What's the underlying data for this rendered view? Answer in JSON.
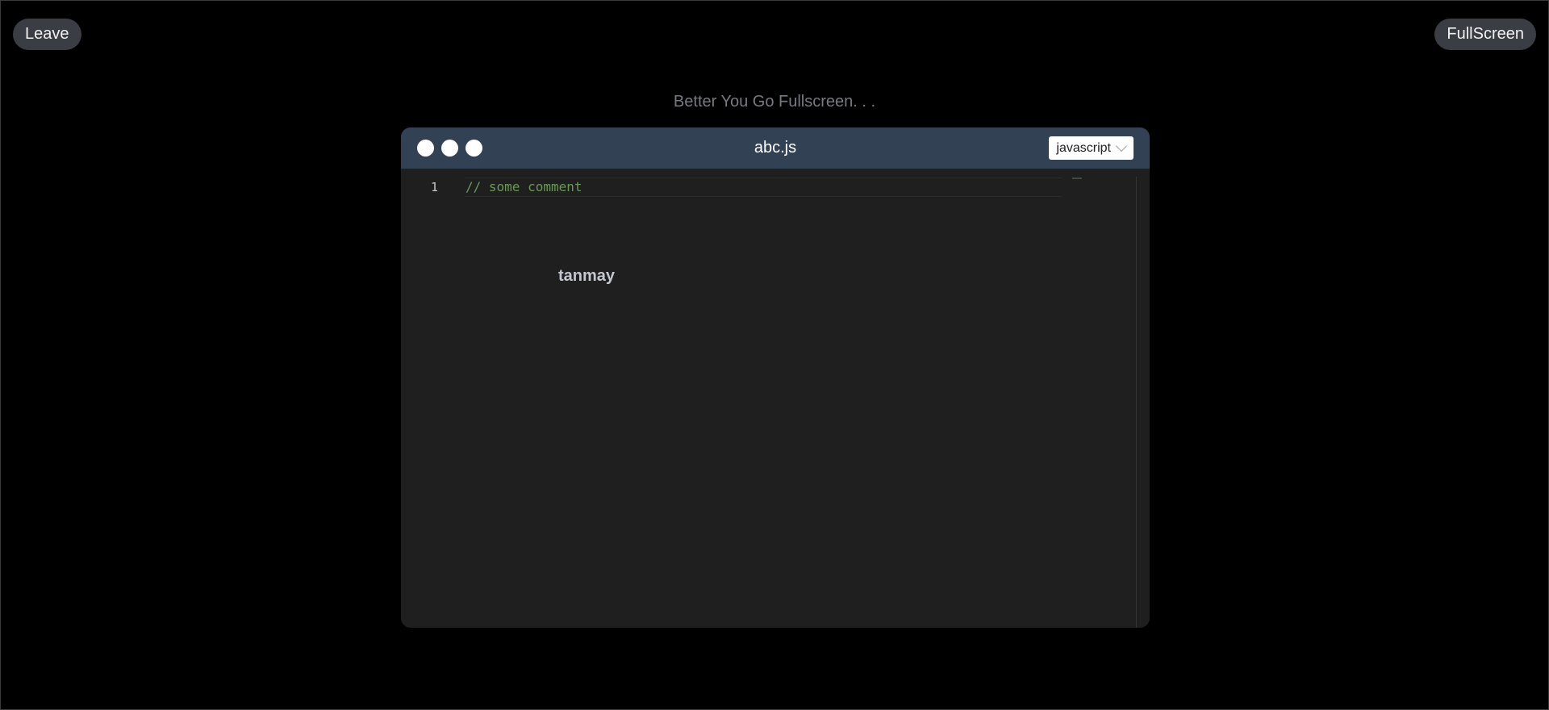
{
  "header": {
    "leave_label": "Leave",
    "fullscreen_label": "FullScreen"
  },
  "hint_text": "Better You Go Fullscreen. . .",
  "editor": {
    "file_name": "abc.js",
    "language": "javascript",
    "lines": [
      {
        "number": "1",
        "text": "// some comment"
      }
    ],
    "collaborator_label": "tanmay",
    "colors": {
      "titlebar": "#334155",
      "editor_background": "#1f1f1f",
      "comment": "#6a9955"
    }
  }
}
